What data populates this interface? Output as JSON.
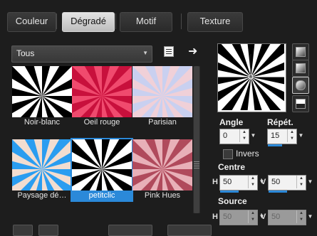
{
  "tabs": [
    {
      "label": "Couleur",
      "selected": false
    },
    {
      "label": "Dégradé",
      "selected": true
    },
    {
      "label": "Motif",
      "selected": false
    },
    {
      "label": "Texture",
      "selected": false
    }
  ],
  "category": {
    "selected": "Tous"
  },
  "gradients": [
    {
      "label": "Noir-blanc",
      "colors": [
        "#000000",
        "#ffffff"
      ]
    },
    {
      "label": "Oeil rouge",
      "colors": [
        "#c8103c",
        "#f04a6e"
      ]
    },
    {
      "label": "Parisian",
      "colors": [
        "#c9d0f0",
        "#f0d0d8"
      ]
    },
    {
      "label": "Paysage dé…",
      "colors": [
        "#2a9df0",
        "#f2ddd0"
      ]
    },
    {
      "label": "petitclic",
      "colors": [
        "#000000",
        "#ffffff"
      ],
      "selected": true
    },
    {
      "label": "Pink Hues",
      "colors": [
        "#b04a5c",
        "#e8b0b8"
      ]
    }
  ],
  "angle": {
    "label": "Angle",
    "value": "0"
  },
  "repeat": {
    "label": "Répét.",
    "value": "15"
  },
  "invert": {
    "label": "Invers",
    "checked": false
  },
  "center": {
    "label": "Centre",
    "h_label": "H",
    "h": "50",
    "v_label": "V",
    "v": "50"
  },
  "source": {
    "label": "Source",
    "h_label": "H",
    "h": "50",
    "v_label": "V",
    "v": "50"
  },
  "accent_color": "#2b89d9"
}
